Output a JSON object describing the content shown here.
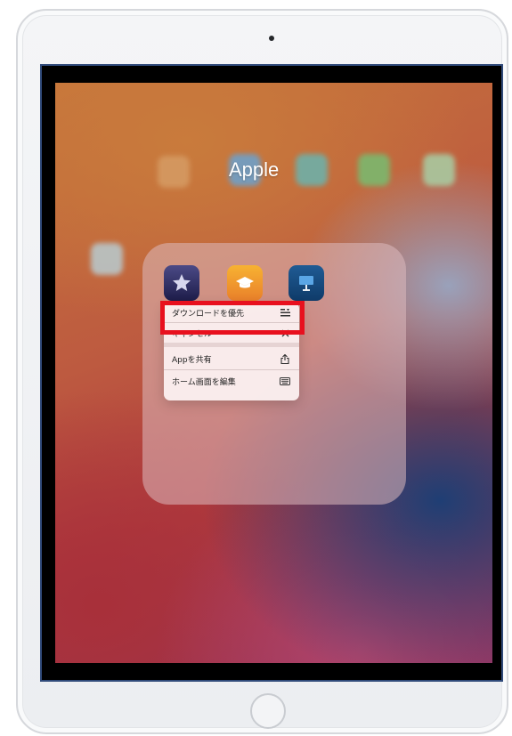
{
  "folder": {
    "title": "Apple",
    "apps": [
      {
        "icon": "star-icon",
        "color": "#2c2b63"
      },
      {
        "icon": "graduation-cap-icon",
        "color": "#f2a02e"
      },
      {
        "icon": "presentation-icon",
        "color": "#1a4c80"
      }
    ]
  },
  "context_menu": {
    "items": [
      {
        "label": "ダウンロードを優先",
        "icon": "download-priority-icon"
      },
      {
        "label": "キャンセル",
        "icon": "close-icon"
      },
      {
        "label": "Appを共有",
        "icon": "share-icon"
      },
      {
        "label": "ホーム画面を編集",
        "icon": "keyboard-icon"
      }
    ]
  },
  "highlight_color": "#e8101e"
}
